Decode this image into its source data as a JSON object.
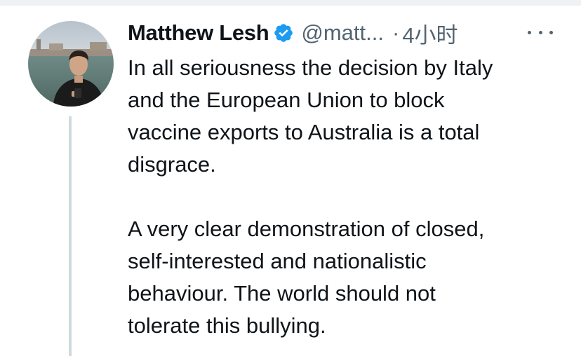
{
  "tweet": {
    "author": {
      "display_name": "Matthew Lesh",
      "handle": "@matt...",
      "verified": true
    },
    "separator": "·",
    "timestamp": "4小时",
    "body": {
      "paragraph_1": [
        "In all seriousness the decision by Italy",
        "and the European Union to block",
        "vaccine exports to Australia is a total",
        "disgrace."
      ],
      "paragraph_2": [
        "A very clear demonstration of closed,",
        "self-interested and nationalistic",
        "behaviour. The world should not",
        "tolerate this bullying."
      ]
    },
    "icons": {
      "verified": "verified-badge-icon",
      "more": "more-options-icon"
    },
    "colors": {
      "verified_blue": "#1d9bf0",
      "muted_text": "#536471",
      "thread_line": "#cfd9de"
    }
  }
}
